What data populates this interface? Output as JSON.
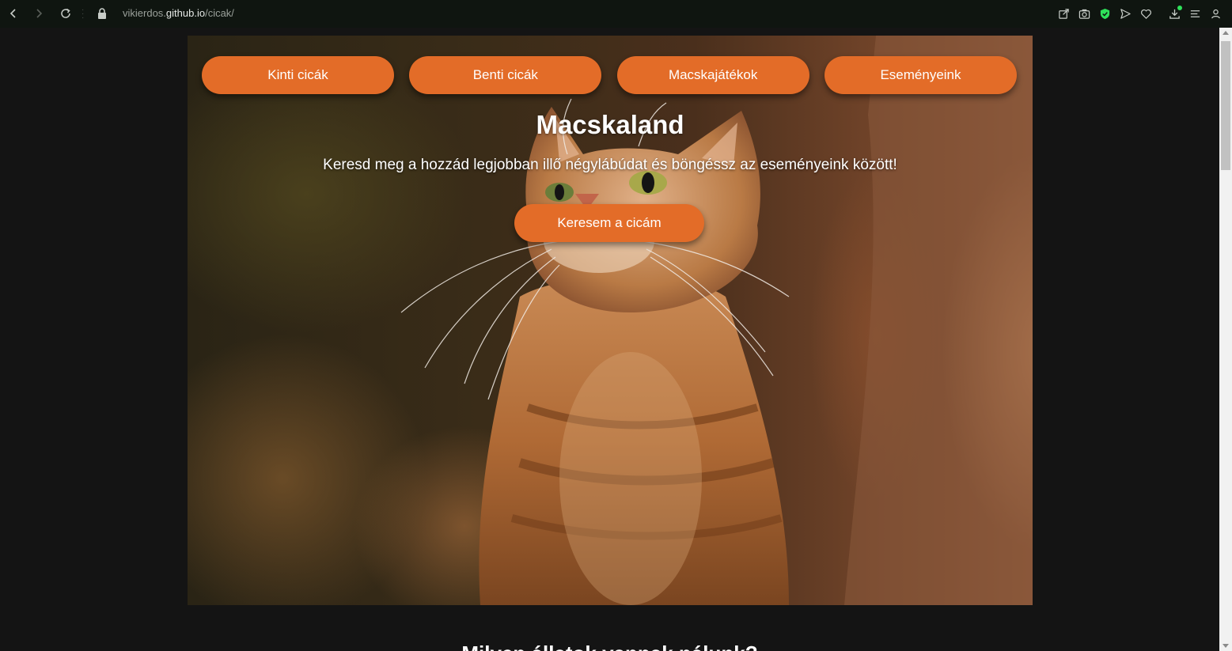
{
  "browser": {
    "url_prefix": "vikierdos.",
    "url_domain": "github.io",
    "url_path": "/cicak/",
    "toolbar_icons": [
      "share-icon",
      "camera-icon",
      "shield-icon",
      "send-icon",
      "heart-icon",
      "download-icon",
      "menu-icon",
      "profile-icon"
    ],
    "accent_green": "#2ee25a"
  },
  "hero": {
    "nav": [
      {
        "label": "Kinti cicák"
      },
      {
        "label": "Benti cicák"
      },
      {
        "label": "Macskajátékok"
      },
      {
        "label": "Eseményeink"
      }
    ],
    "title": "Macskaland",
    "subtitle": "Keresd meg a hozzád legjobban illő négylábúdat és böngéssz az eseményeink között!",
    "cta_label": "Keresem a cicám",
    "accent": "#e36c28"
  },
  "next_section": {
    "heading": "Milyen állatok vannak nálunk?"
  }
}
